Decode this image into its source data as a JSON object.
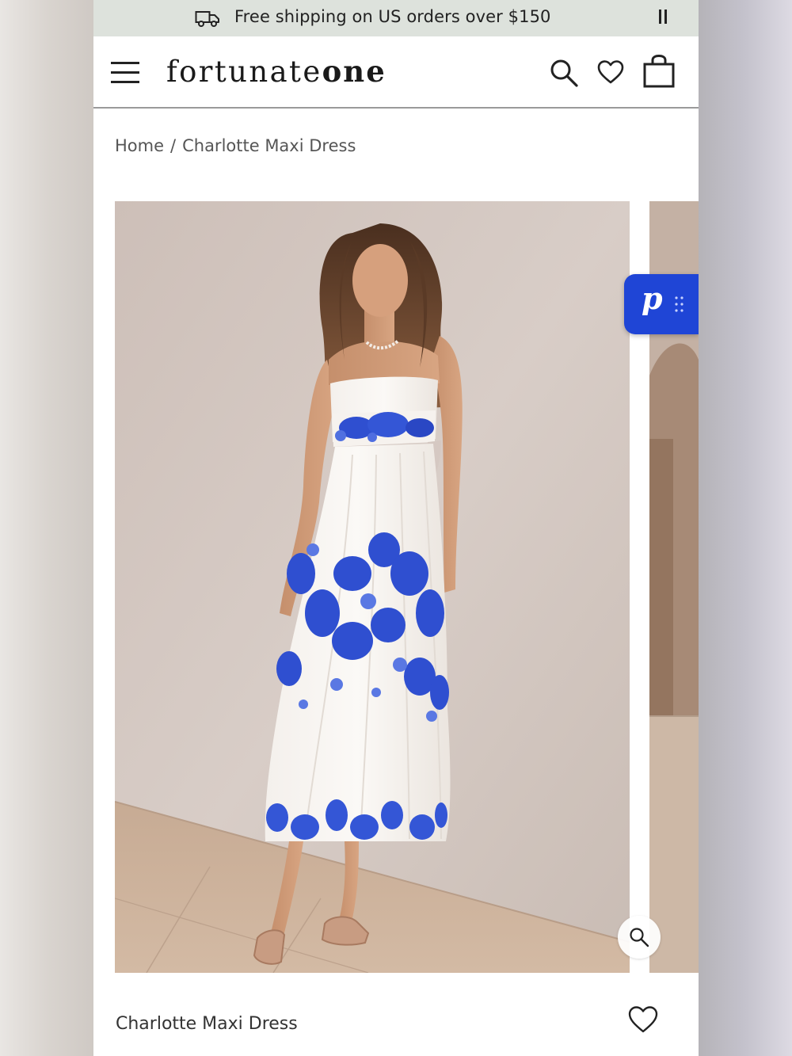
{
  "announcement": {
    "text": "Free shipping on US orders over $150",
    "icon": "truck-icon",
    "pause_icon": "pause-icon"
  },
  "header": {
    "logo_regular": "fortunate",
    "logo_bold": "one",
    "menu_icon": "hamburger-menu-icon",
    "search_icon": "search-icon",
    "wishlist_icon": "heart-icon",
    "cart_icon": "shopping-bag-icon"
  },
  "breadcrumb": {
    "home": "Home",
    "separator": "/",
    "current": "Charlotte Maxi Dress"
  },
  "gallery": {
    "main_image": "model wearing white maxi dress with blue floral print",
    "zoom_icon": "zoom-icon",
    "widget_letter": "p"
  },
  "product": {
    "title": "Charlotte Maxi Dress",
    "wishlist_icon": "heart-icon"
  },
  "colors": {
    "announcement_bg": "#dde2dc",
    "widget_blue": "#1f45d6",
    "print_blue": "#2f4fd0"
  }
}
